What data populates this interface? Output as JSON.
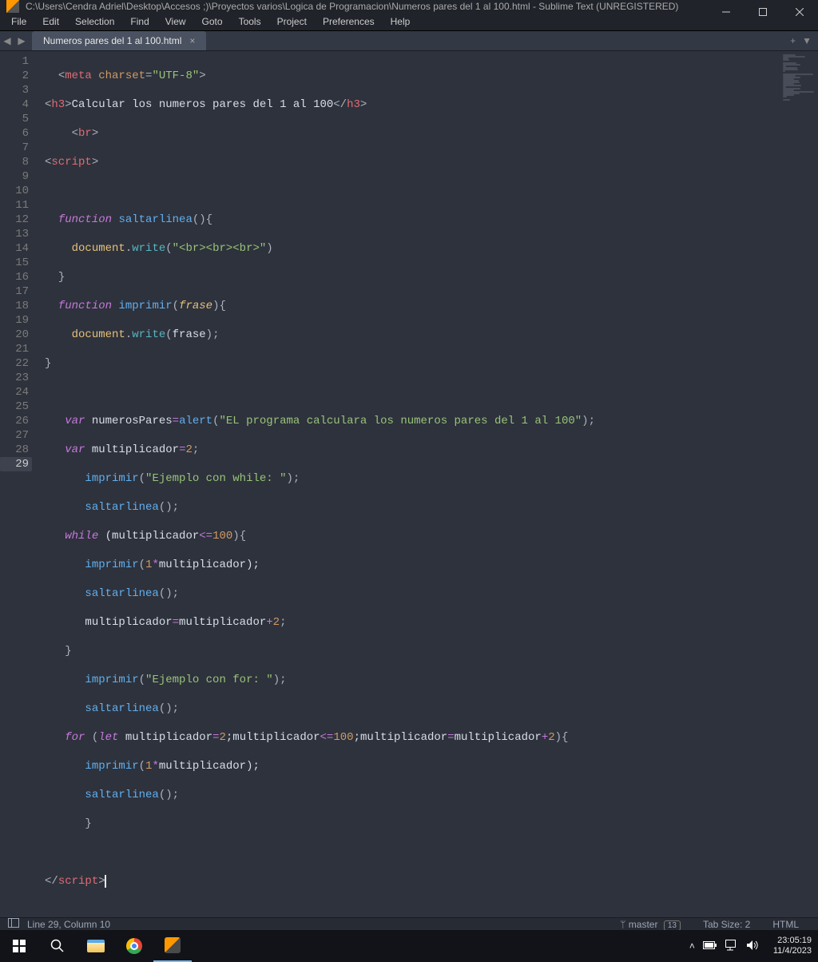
{
  "window": {
    "title": "C:\\Users\\Cendra Adriel\\Desktop\\Accesos ;)\\Proyectos varios\\Logica de Programacion\\Numeros pares del 1 al 100.html - Sublime Text (UNREGISTERED)"
  },
  "menu": {
    "file": "File",
    "edit": "Edit",
    "selection": "Selection",
    "find": "Find",
    "view": "View",
    "goto": "Goto",
    "tools": "Tools",
    "project": "Project",
    "preferences": "Preferences",
    "help": "Help"
  },
  "tab": {
    "name": "Numeros pares del 1 al 100.html"
  },
  "status": {
    "cursor": "Line 29, Column 10",
    "branch_label": "master",
    "branch_count": "13",
    "tab_size": "Tab Size: 2",
    "syntax": "HTML"
  },
  "tray": {
    "time": "23:05:19",
    "date": "11/4/2023"
  },
  "code": {
    "l1": {
      "a": "<",
      "b": "meta",
      "c": " charset",
      "d": "=",
      "e": "\"UTF-8\"",
      "f": ">"
    },
    "l2": {
      "a": "<",
      "b": "h3",
      "c": ">",
      "d": "Calcular los numeros pares del 1 al 100",
      "e": "</",
      "f": "h3",
      "g": ">"
    },
    "l3": {
      "a": "<",
      "b": "br",
      "c": ">"
    },
    "l4": {
      "a": "<",
      "b": "script",
      "c": ">"
    },
    "l6": {
      "a": "function",
      "b": " ",
      "c": "saltarlinea",
      "d": "(){"
    },
    "l7": {
      "a": "document",
      "b": ".",
      "c": "write",
      "d": "(",
      "e": "\"<br><br><br>\"",
      "f": ")"
    },
    "l8": {
      "a": "}"
    },
    "l9": {
      "a": "function",
      "b": " ",
      "c": "imprimir",
      "d": "(",
      "e": "frase",
      "f": "){"
    },
    "l10": {
      "a": "document",
      "b": ".",
      "c": "write",
      "d": "(",
      "e": "frase",
      "f": ");"
    },
    "l11": {
      "a": "}"
    },
    "l13": {
      "a": "var",
      "b": " numerosPares",
      "c": "=",
      "d": "alert",
      "e": "(",
      "f": "\"EL programa calculara los numeros pares del 1 al 100\"",
      "g": ");"
    },
    "l14": {
      "a": "var",
      "b": " multiplicador",
      "c": "=",
      "d": "2",
      "e": ";"
    },
    "l15": {
      "a": "imprimir",
      "b": "(",
      "c": "\"Ejemplo con while: \"",
      "d": ");"
    },
    "l16": {
      "a": "saltarlinea",
      "b": "();"
    },
    "l17": {
      "a": "while",
      "b": " (multiplicador",
      "c": "<=",
      "d": "100",
      "e": "){"
    },
    "l18": {
      "a": "imprimir",
      "b": "(",
      "c": "1",
      "d": "*",
      "e": "multiplicador);"
    },
    "l19": {
      "a": "saltarlinea",
      "b": "();"
    },
    "l20": {
      "a": "multiplicador",
      "b": "=",
      "c": "multiplicador",
      "d": "+",
      "e": "2",
      "f": ";"
    },
    "l21": {
      "a": "}"
    },
    "l22": {
      "a": "imprimir",
      "b": "(",
      "c": "\"Ejemplo con for: \"",
      "d": ");"
    },
    "l23": {
      "a": "saltarlinea",
      "b": "();"
    },
    "l24": {
      "a": "for",
      "b": " (",
      "c": "let",
      "d": " multiplicador",
      "e": "=",
      "f": "2",
      "g": ";multiplicador",
      "h": "<=",
      "i": "100",
      "j": ";multiplicador",
      "k": "=",
      "l": "multiplicador",
      "m": "+",
      "n": "2",
      "o": "){"
    },
    "l25": {
      "a": "imprimir",
      "b": "(",
      "c": "1",
      "d": "*",
      "e": "multiplicador);"
    },
    "l26": {
      "a": "saltarlinea",
      "b": "();"
    },
    "l27": {
      "a": "}"
    },
    "l29": {
      "a": "</",
      "b": "script",
      "c": ">"
    }
  }
}
